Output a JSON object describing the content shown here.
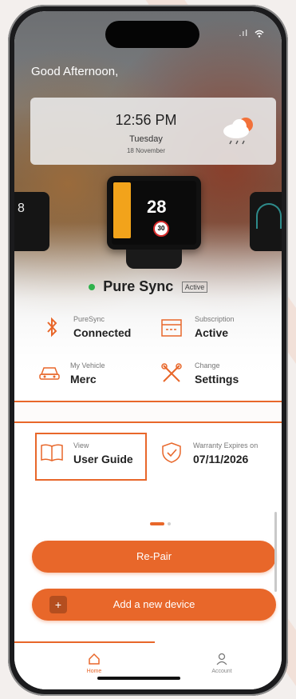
{
  "status_bar": {
    "signal": ".ıl",
    "wifi": "wifi-icon"
  },
  "greeting": "Good Afternoon,",
  "clock": {
    "time": "12:56 PM",
    "day": "Tuesday",
    "date": "18 November"
  },
  "device_display": {
    "speed": "28",
    "limit": "30"
  },
  "device": {
    "name": "Pure Sync",
    "state": "Active"
  },
  "cards": {
    "puresync": {
      "label": "PureSync",
      "value": "Connected"
    },
    "subscription": {
      "label": "Subscription",
      "value": "Active"
    },
    "vehicle": {
      "label": "My Vehicle",
      "value": "Merc"
    },
    "settings": {
      "label": "Change",
      "value": "Settings"
    },
    "guide": {
      "label": "View",
      "value": "User Guide"
    },
    "warranty": {
      "label": "Warranty Expires on",
      "value": "07/11/2026"
    }
  },
  "buttons": {
    "repair": "Re-Pair",
    "add_device": "Add a new device",
    "plus": "+"
  },
  "tabs": [
    {
      "label": "Home"
    },
    {
      "label": "Account"
    }
  ],
  "colors": {
    "accent": "#e8672a",
    "active_dot": "#2fb24c"
  }
}
